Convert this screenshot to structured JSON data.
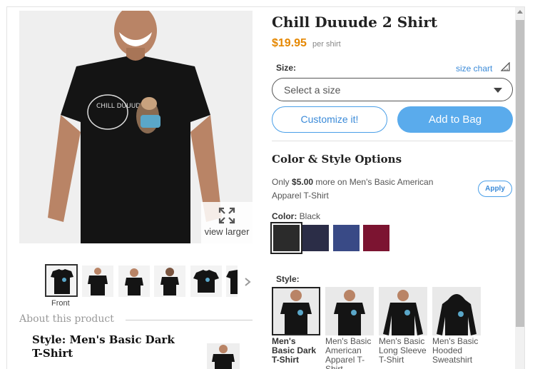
{
  "product": {
    "title": "Chill Duuude 2 Shirt",
    "price": "$19.95",
    "price_unit": "per shirt",
    "graphic_text": "CHILL DUUUDE"
  },
  "gallery": {
    "view_larger": "view larger",
    "selected_label": "Front",
    "thumb_count": 6
  },
  "about": {
    "title": "About this product",
    "style_heading": "Style: Men's Basic Dark T-Shirt"
  },
  "size": {
    "label": "Size:",
    "chart_link": "size chart",
    "placeholder": "Select a size"
  },
  "buttons": {
    "customize": "Customize it!",
    "add_to_bag": "Add to Bag"
  },
  "options": {
    "title": "Color & Style Options",
    "upsell_prefix": "Only ",
    "upsell_amount": "$5.00",
    "upsell_suffix": " more on Men's Basic American Apparel T-Shirt",
    "apply": "Apply"
  },
  "color": {
    "label": "Color:",
    "value": "Black",
    "swatches": [
      {
        "name": "black",
        "hex": "#2b2b2b"
      },
      {
        "name": "navy",
        "hex": "#2b2d47"
      },
      {
        "name": "royal",
        "hex": "#394a86"
      },
      {
        "name": "maroon",
        "hex": "#7c1431"
      }
    ]
  },
  "style": {
    "label": "Style:",
    "items": [
      {
        "name": "Men's Basic Dark T-Shirt"
      },
      {
        "name": "Men's Basic American Apparel T-Shirt"
      },
      {
        "name": "Men's Basic Long Sleeve T-Shirt"
      },
      {
        "name": "Men's Basic Hooded Sweatshirt"
      }
    ]
  },
  "colors": {
    "accent": "#3a8ad8",
    "button": "#5aabec",
    "price": "#e58700"
  }
}
